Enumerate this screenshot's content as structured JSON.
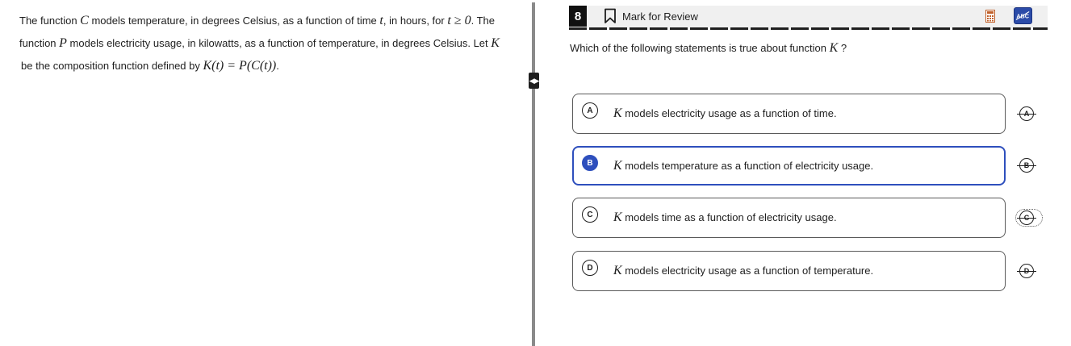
{
  "passage": {
    "line1": {
      "t1": "The function ",
      "m1": "C",
      "t2": " models temperature, in degrees Celsius, as a function of time ",
      "m2": "t",
      "t3": ", in hours, for ",
      "m3": "t ≥ 0",
      "t4": ". The"
    },
    "line2": {
      "t1": "function ",
      "m1": "P",
      "t2": " models electricity usage, in kilowatts, as a function of temperature, in degrees Celsius. Let ",
      "m2": "K"
    },
    "line3": {
      "t1": "be the composition function defined by ",
      "m1": "K(t) = P(C(t))",
      "t2": "."
    }
  },
  "divider": {
    "handle_glyph": "◀▶"
  },
  "header": {
    "question_number": "8",
    "mark_for_review": "Mark for Review",
    "calculator_icon": "calculator-icon",
    "abc_icon": "abc-strikethrough-icon"
  },
  "question": {
    "text": "Which of the following statements is true about function ",
    "var": "K",
    "end": "?"
  },
  "choices": [
    {
      "letter": "A",
      "var": "K",
      "text": " models electricity usage as a function of time.",
      "selected": false
    },
    {
      "letter": "B",
      "var": "K",
      "text": " models temperature as a function of electricity usage.",
      "selected": true
    },
    {
      "letter": "C",
      "var": "K",
      "text": " models time as a function of electricity usage.",
      "selected": false
    },
    {
      "letter": "D",
      "var": "K",
      "text": " models electricity usage as a function of temperature.",
      "selected": false
    }
  ],
  "colors": {
    "accent": "#2e4fbd",
    "header_bg": "#f0f0f0",
    "text": "#1e1e1e"
  }
}
